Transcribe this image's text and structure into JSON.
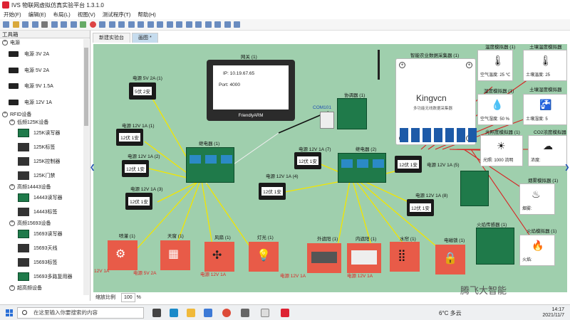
{
  "window": {
    "title": "IVS 物联网虚拟仿真实验平台 1.3.1.0"
  },
  "menu": [
    "开始(F)",
    "编辑(E)",
    "布局(L)",
    "视图(V)",
    "测试程序(T)",
    "帮助(H)"
  ],
  "sidebar": {
    "title": "工具箱",
    "power_section": "电源",
    "power_items": [
      "电源 3V   2A",
      "电源 5V   2A",
      "电源 9V 1.5A",
      "电源 12V   1A"
    ],
    "rfid_section": "RFID设备",
    "lf_section": "低频125K设备",
    "lf_items": [
      "125K读写器",
      "125K标签",
      "125K控制器",
      "125K门禁"
    ],
    "hf_section": "高频14443设备",
    "hf_items": [
      "14443读写器",
      "14443标签"
    ],
    "hf2_section": "高频15693设备",
    "hf2_items": [
      "15693读写器",
      "15693天线",
      "15693标签",
      "15693多路复用器"
    ],
    "more_section": "超高频设备"
  },
  "tabs": [
    "新建实验台",
    "画图 *"
  ],
  "canvas": {
    "gateway": {
      "label": "网关 (1)",
      "ip": "IP:   10.19.67.65",
      "port": "Port:   4000",
      "brand": "FriendlyARM"
    },
    "com_label": "COM101",
    "coordinator_label": "协调器 (1)",
    "collector_label": "智能农业数据采集器 (1)",
    "collector_brand": "Kingvcn",
    "collector_sub": "多功能无线数据采集器",
    "relay1_label": "继电器 (1)",
    "relay2_label": "继电器 (2)",
    "power_units": [
      {
        "label": "电源 5V   2A (1)",
        "text": "5伏 2安"
      },
      {
        "label": "电源 12V   1A (1)",
        "text": "12伏 1安"
      },
      {
        "label": "电源 12V   1A (2)",
        "text": "12伏 1安"
      },
      {
        "label": "电源 12V   1A (3)",
        "text": "12伏 1安"
      },
      {
        "label": "电源 12V   1A (4)",
        "text": "12伏 1安"
      },
      {
        "label": "电源 12V   1A (7)",
        "text": "12伏 1安"
      },
      {
        "label": "电源 12V   1A (5)",
        "text": "12伏 1安"
      },
      {
        "label": "电源 12V   1A (8)",
        "text": "12伏 1安"
      }
    ],
    "sensors": [
      {
        "label": "温度模拟器 (1)",
        "value": "空气温度: 25 ℃"
      },
      {
        "label": "土壤温度模拟器",
        "value": "土壤温度: 25"
      },
      {
        "label": "湿度模拟器 (1)",
        "value": "空气湿度: 50 %"
      },
      {
        "label": "土壤湿度模拟器",
        "value": "土壤湿度: 5"
      },
      {
        "label": "光照度模拟器 (1)",
        "value": "光照: 1000 流明"
      },
      {
        "label": "CO2浓度模拟器",
        "value": "浓度:"
      },
      {
        "label": "烟雾模拟器 (1)",
        "value": "烟雾:"
      },
      {
        "label": "火焰模拟器 (1)",
        "value": "火焰:"
      }
    ],
    "fire_sensor_label": "火焰传感器 (1)",
    "actuators": [
      {
        "label": "喷灌 (1)",
        "volt": "12V 1A"
      },
      {
        "label": "天窗 (1)",
        "volt": "电源 5V 2A"
      },
      {
        "label": "风扇 (1)",
        "volt": "电源 12V 1A"
      },
      {
        "label": "灯光 (1)",
        "volt": ""
      },
      {
        "label": "外遮阳 (1)",
        "volt": "电源 12V 1A"
      },
      {
        "label": "内遮阳 (1)",
        "volt": "电源 12V 1A"
      },
      {
        "label": "水帘 (1)",
        "volt": ""
      },
      {
        "label": "电磁锁 (1)",
        "volt": ""
      }
    ]
  },
  "statusbar": {
    "zoom_label": "缩放比例",
    "zoom_value": "100",
    "unit": "%"
  },
  "watermark": "腾飞大智能",
  "taskbar": {
    "search_placeholder": "在这里输入你要搜索的内容",
    "weather": "6°C  多云",
    "time": "14:17",
    "date": "2021/11/7"
  }
}
